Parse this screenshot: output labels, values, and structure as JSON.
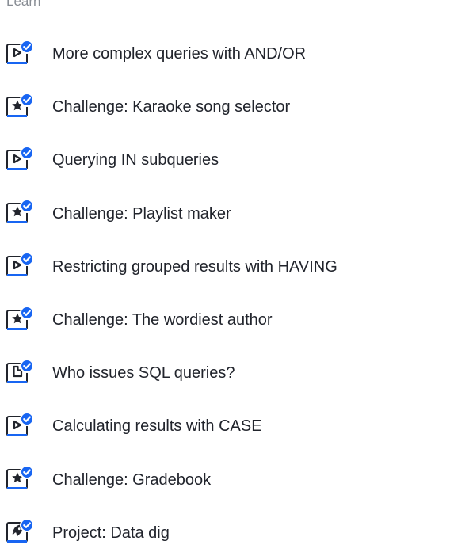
{
  "section": {
    "label": "Learn"
  },
  "items": [
    {
      "label": "More complex queries with AND/OR",
      "icon": "video-icon"
    },
    {
      "label": "Challenge: Karaoke song selector",
      "icon": "star-icon"
    },
    {
      "label": "Querying IN subqueries",
      "icon": "video-icon"
    },
    {
      "label": "Challenge: Playlist maker",
      "icon": "star-icon"
    },
    {
      "label": "Restricting grouped results with HAVING",
      "icon": "video-icon"
    },
    {
      "label": "Challenge: The wordiest author",
      "icon": "star-icon"
    },
    {
      "label": "Who issues SQL queries?",
      "icon": "article-icon"
    },
    {
      "label": "Calculating results with CASE",
      "icon": "video-icon"
    },
    {
      "label": "Challenge: Gradebook",
      "icon": "star-icon"
    },
    {
      "label": "Project: Data dig",
      "icon": "project-icon"
    }
  ],
  "colors": {
    "icon_border": "#21242c",
    "icon_underline": "#1865f2",
    "check_badge": "#1865f2",
    "text": "#21242c",
    "muted": "#888d94"
  }
}
